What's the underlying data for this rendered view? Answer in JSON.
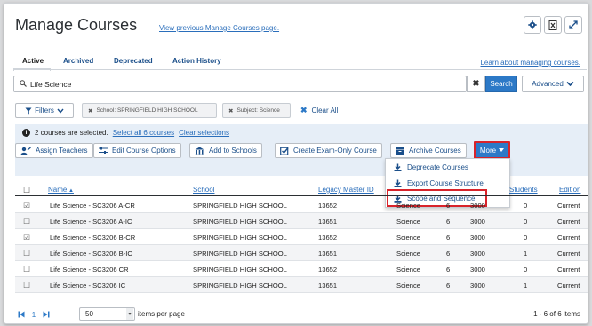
{
  "header": {
    "title": "Manage Courses",
    "previous_link": "View previous Manage Courses page."
  },
  "tabs": [
    {
      "label": "Active",
      "active": true
    },
    {
      "label": "Archived",
      "active": false
    },
    {
      "label": "Deprecated",
      "active": false
    },
    {
      "label": "Action History",
      "active": false
    }
  ],
  "learn_link": "Learn about managing courses.",
  "search": {
    "value": "Life Science",
    "clear_label": "✖",
    "search_label": "Search",
    "advanced_label": "Advanced"
  },
  "filters": {
    "filters_label": "Filters",
    "chips": [
      "School: SPRINGFIELD HIGH SCHOOL",
      "Subject: Science"
    ],
    "clear_all_label": "Clear All"
  },
  "selection": {
    "message": "2 courses are selected.",
    "select_all_label": "Select all 6 courses",
    "clear_selections_label": "Clear selections"
  },
  "actions": [
    {
      "label": "Assign Teachers",
      "icon": "assign-teachers-icon"
    },
    {
      "label": "Edit Course Options",
      "icon": "sliders-icon"
    },
    {
      "label": "Add to Schools",
      "icon": "school-building-icon"
    },
    {
      "label": "Create Exam-Only Course",
      "icon": "checkbox-icon"
    },
    {
      "label": "Archive Courses",
      "icon": "archive-icon"
    }
  ],
  "more": {
    "label": "More",
    "items": [
      "Deprecate Courses",
      "Export Course Structure",
      "Scope and Sequence"
    ]
  },
  "table": {
    "columns": [
      "Name",
      "School",
      "Legacy Master ID",
      "",
      "",
      "",
      "Students",
      "Edition"
    ],
    "rows": [
      {
        "checked": true,
        "name": "Life Science - SC3206 A-CR",
        "school": "SPRINGFIELD HIGH SCHOOL",
        "legacy_id": "13652",
        "subject": "Science",
        "grade": "6",
        "credits": "3000",
        "students": "0",
        "edition": "Current"
      },
      {
        "checked": false,
        "name": "Life Science - SC3206 A-IC",
        "school": "SPRINGFIELD HIGH SCHOOL",
        "legacy_id": "13651",
        "subject": "Science",
        "grade": "6",
        "credits": "3000",
        "students": "0",
        "edition": "Current"
      },
      {
        "checked": true,
        "name": "Life Science - SC3206 B-CR",
        "school": "SPRINGFIELD HIGH SCHOOL",
        "legacy_id": "13652",
        "subject": "Science",
        "grade": "6",
        "credits": "3000",
        "students": "0",
        "edition": "Current"
      },
      {
        "checked": false,
        "name": "Life Science - SC3206 B-IC",
        "school": "SPRINGFIELD HIGH SCHOOL",
        "legacy_id": "13651",
        "subject": "Science",
        "grade": "6",
        "credits": "3000",
        "students": "1",
        "edition": "Current"
      },
      {
        "checked": false,
        "name": "Life Science - SC3206 CR",
        "school": "SPRINGFIELD HIGH SCHOOL",
        "legacy_id": "13652",
        "subject": "Science",
        "grade": "6",
        "credits": "3000",
        "students": "0",
        "edition": "Current"
      },
      {
        "checked": false,
        "name": "Life Science - SC3206 IC",
        "school": "SPRINGFIELD HIGH SCHOOL",
        "legacy_id": "13651",
        "subject": "Science",
        "grade": "6",
        "credits": "3000",
        "students": "1",
        "edition": "Current"
      }
    ]
  },
  "pagination": {
    "current_page": "1",
    "per_page": "50",
    "per_page_label": "items per page",
    "summary": "1 - 6 of 6 items"
  },
  "colors": {
    "primary": "#2c79c7",
    "highlight": "#d8232a",
    "link": "#2a6ebb"
  }
}
